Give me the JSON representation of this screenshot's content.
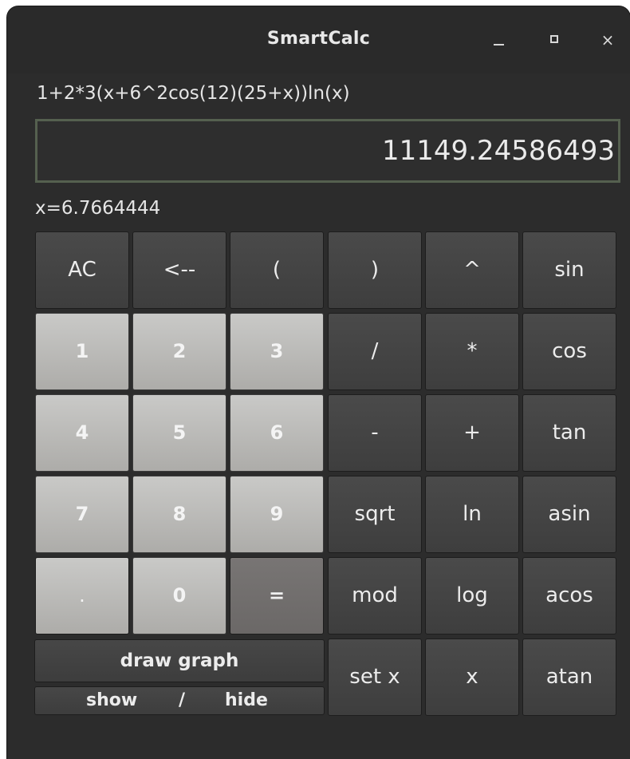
{
  "window": {
    "title": "SmartCalc",
    "controls": {
      "minimize": "minimize-icon",
      "maximize": "maximize-icon",
      "close": "×"
    }
  },
  "expression": "1+2*3(x+6^2cos(12)(25+x))ln(x)",
  "result": "11149.24586493",
  "x_value": "x=6.7664444",
  "keys": {
    "ac": "AC",
    "backspace": "<--",
    "lparen": "(",
    "rparen": ")",
    "pow": "^",
    "sin": "sin",
    "d1": "1",
    "d2": "2",
    "d3": "3",
    "div": "/",
    "mul": "*",
    "cos": "cos",
    "d4": "4",
    "d5": "5",
    "d6": "6",
    "minus": "-",
    "plus": "+",
    "tan": "tan",
    "d7": "7",
    "d8": "8",
    "d9": "9",
    "sqrt": "sqrt",
    "ln": "ln",
    "asin": "asin",
    "dot": ".",
    "d0": "0",
    "equals": "=",
    "mod": "mod",
    "log": "log",
    "acos": "acos",
    "set_x": "set x",
    "x": "x",
    "atan": "atan"
  },
  "graph": {
    "draw": "draw graph",
    "show": "show",
    "slash": "/",
    "hide": "hide"
  },
  "colors": {
    "window_bg": "#2c2c2c",
    "key_dark": "#434343",
    "key_light": "#bdbcba",
    "key_equals": "#726f6e",
    "display_border": "#55604f"
  }
}
